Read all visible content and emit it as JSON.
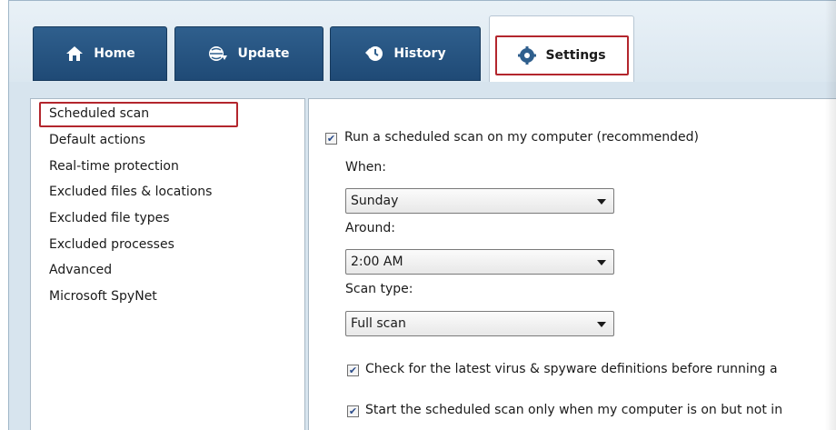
{
  "tabs": {
    "home": {
      "label": "Home",
      "icon": "home-icon"
    },
    "update": {
      "label": "Update",
      "icon": "globe-update-icon"
    },
    "history": {
      "label": "History",
      "icon": "history-icon"
    },
    "settings": {
      "label": "Settings",
      "icon": "gear-icon",
      "selected": true
    }
  },
  "sidebar": {
    "items": [
      {
        "label": "Scheduled scan",
        "selected": true
      },
      {
        "label": "Default actions"
      },
      {
        "label": "Real-time protection"
      },
      {
        "label": "Excluded files & locations"
      },
      {
        "label": "Excluded file types"
      },
      {
        "label": "Excluded processes"
      },
      {
        "label": "Advanced"
      },
      {
        "label": "Microsoft SpyNet"
      }
    ]
  },
  "scheduled_scan": {
    "run_scheduled": {
      "label": "Run a scheduled scan on my computer (recommended)",
      "checked": true
    },
    "when": {
      "label": "When:",
      "value": "Sunday"
    },
    "around": {
      "label": "Around:",
      "value": "2:00 AM"
    },
    "scan_type": {
      "label": "Scan type:",
      "value": "Full scan"
    },
    "check_definitions": {
      "label": "Check for the latest virus & spyware definitions before running a",
      "checked": true
    },
    "start_only_idle": {
      "label": "Start the scheduled scan only when my computer is on but not in",
      "checked": true
    }
  },
  "colors": {
    "tab_blue": "#2f5f8d",
    "highlight_red": "#b3262d",
    "content_bg": "#d7e4ee"
  }
}
